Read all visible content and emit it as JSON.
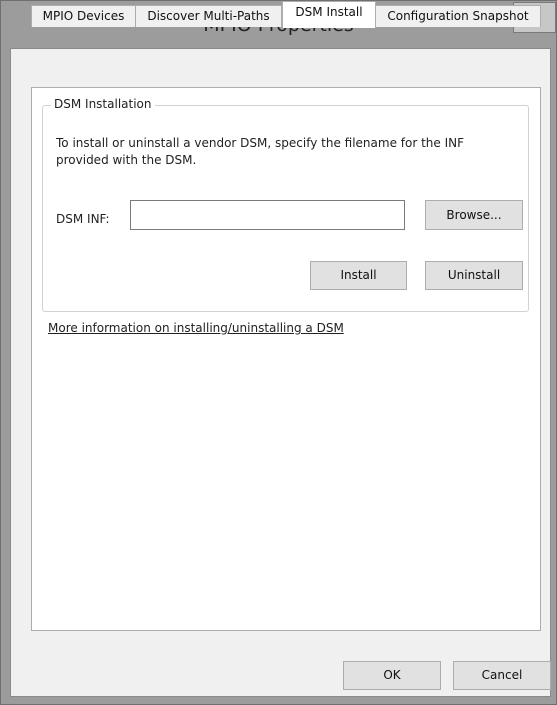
{
  "window": {
    "title": "MPIO Properties",
    "close_glyph": "x"
  },
  "tabs": [
    {
      "label": "MPIO Devices",
      "active": false
    },
    {
      "label": "Discover Multi-Paths",
      "active": false
    },
    {
      "label": "DSM Install",
      "active": true
    },
    {
      "label": "Configuration Snapshot",
      "active": false
    }
  ],
  "dsm_installation": {
    "group_title": "DSM Installation",
    "description": "To install or uninstall a vendor DSM, specify the filename for the INF provided with the DSM.",
    "inf_label": "DSM INF:",
    "inf_value": "",
    "browse_label": "Browse...",
    "install_label": "Install",
    "uninstall_label": "Uninstall"
  },
  "info_link": "More information on installing/uninstalling a DSM",
  "footer": {
    "ok_label": "OK",
    "cancel_label": "Cancel"
  },
  "icons": {
    "close": "close-icon"
  },
  "colors": {
    "titlebar": "#9c9c9c",
    "panel": "#ffffff",
    "dialog_bg": "#f0f0f0"
  }
}
